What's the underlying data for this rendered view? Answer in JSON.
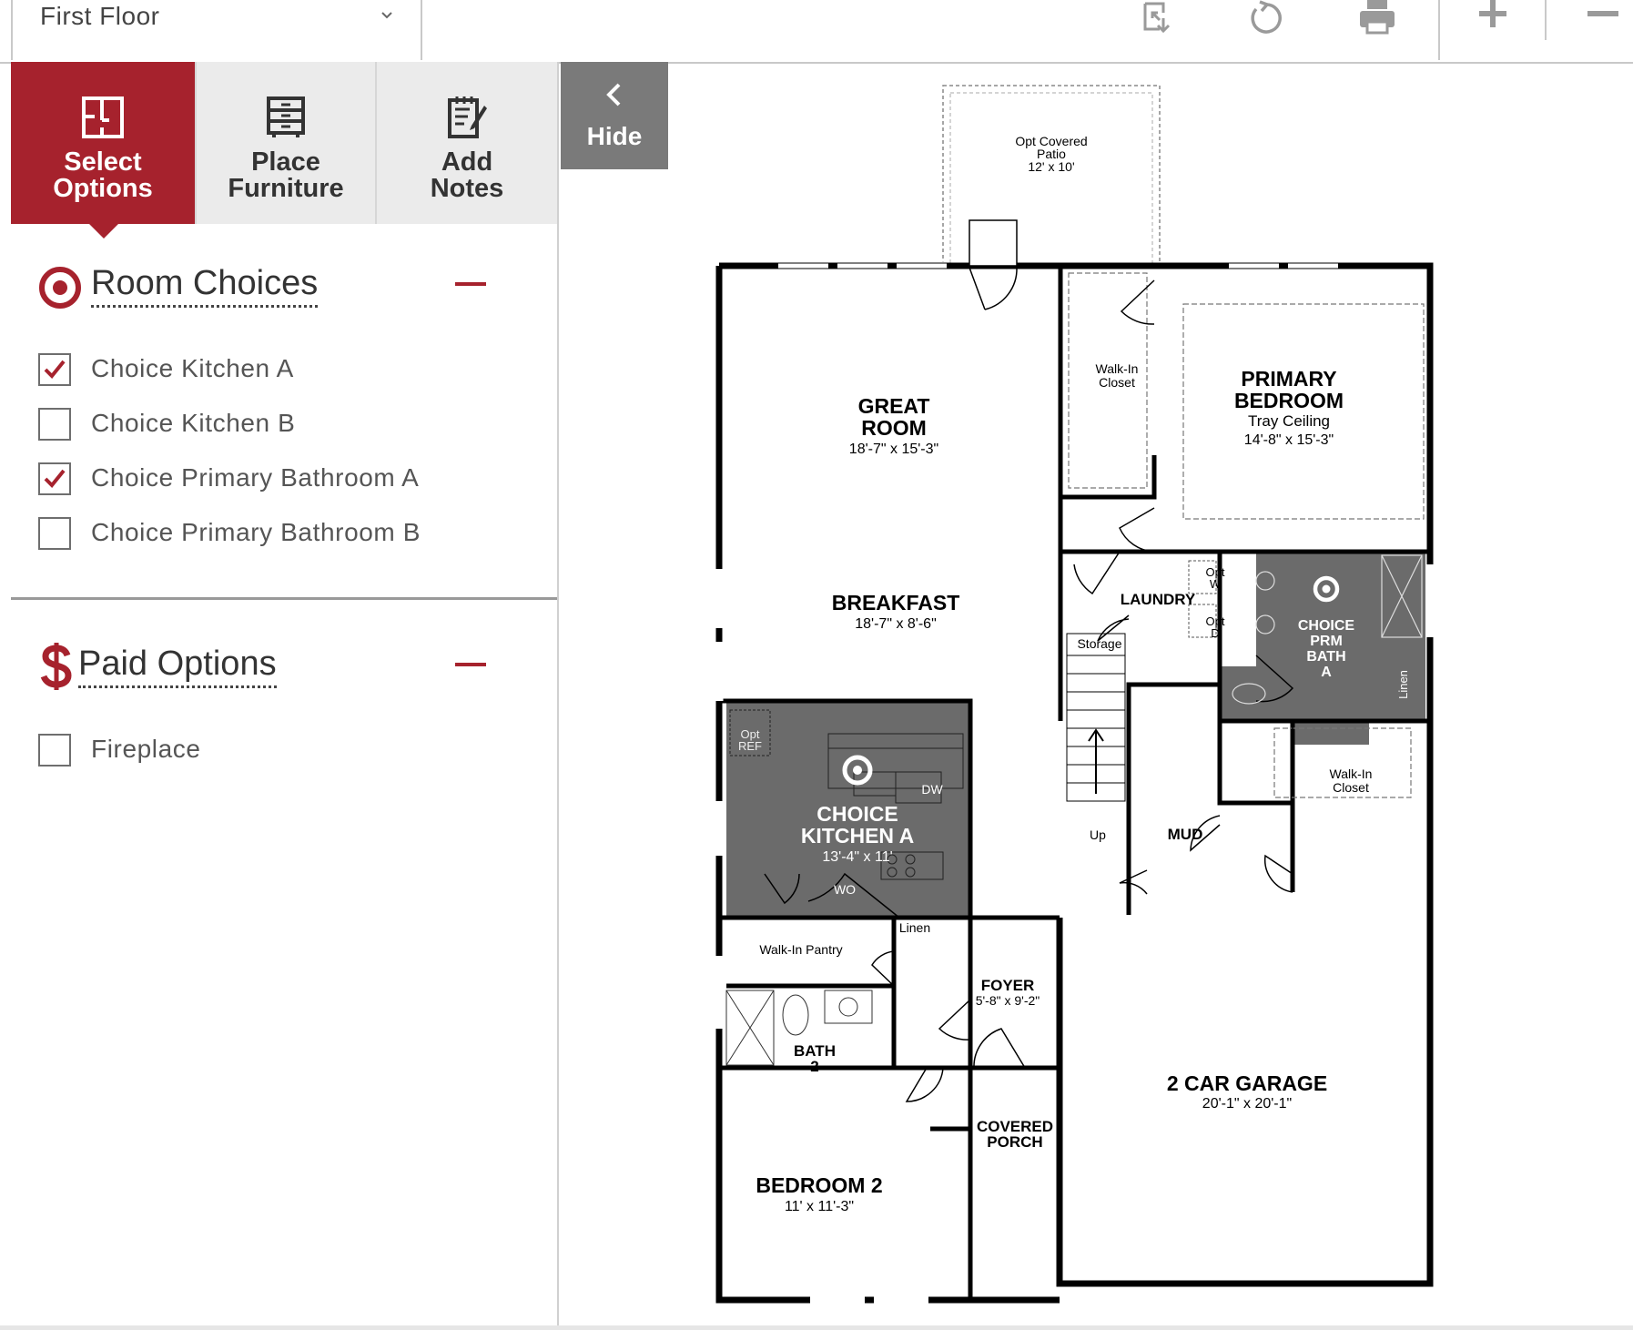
{
  "toolbar": {
    "floor_selected": "First Floor",
    "icons": [
      "swap-icon",
      "reset-icon",
      "print-icon",
      "zoom-in-icon",
      "zoom-out-icon"
    ]
  },
  "tabs": [
    {
      "label": "Select\nOptions",
      "active": true,
      "icon": "floorplan-icon"
    },
    {
      "label": "Place\nFurniture",
      "active": false,
      "icon": "dresser-icon"
    },
    {
      "label": "Add\nNotes",
      "active": false,
      "icon": "notepad-icon"
    }
  ],
  "room_choices": {
    "title": "Room Choices",
    "icon": "target-icon",
    "items": [
      {
        "label": "Choice Kitchen A",
        "checked": true
      },
      {
        "label": "Choice Kitchen B",
        "checked": false
      },
      {
        "label": "Choice Primary Bathroom A",
        "checked": true
      },
      {
        "label": "Choice Primary Bathroom B",
        "checked": false
      }
    ]
  },
  "paid_options": {
    "title": "Paid Options",
    "icon": "dollar-icon",
    "items": [
      {
        "label": "Fireplace",
        "checked": false
      }
    ]
  },
  "hide_button": {
    "label": "Hide"
  },
  "colors": {
    "accent": "#a6222d",
    "tab_bg": "#ebebeb",
    "highlight_room": "#6b6b6b"
  },
  "floorplan": {
    "rooms": {
      "patio_1": "Opt Covered",
      "patio_2": "Patio",
      "patio_dim": "12' x 10'",
      "great_room_1": "GREAT",
      "great_room_2": "ROOM",
      "great_room_dim": "18'-7\" x 15'-3\"",
      "walkin_closet_1a": "Walk-In",
      "walkin_closet_1b": "Closet",
      "primary_bedroom_1": "PRIMARY",
      "primary_bedroom_2": "BEDROOM",
      "primary_bedroom_note": "Tray Ceiling",
      "primary_bedroom_dim": "14'-8\" x 15'-3\"",
      "breakfast": "BREAKFAST",
      "breakfast_dim": "18'-7\" x 8'-6\"",
      "laundry": "LAUNDRY",
      "storage": "Storage",
      "opt_w_1": "Opt",
      "opt_w_2": "W",
      "opt_d_1": "Opt",
      "opt_d_2": "D",
      "choice_bath_1": "CHOICE",
      "choice_bath_2": "PRM",
      "choice_bath_3": "BATH",
      "choice_bath_4": "A",
      "linen_1": "Linen",
      "walkin_closet_2a": "Walk-In",
      "walkin_closet_2b": "Closet",
      "up": "Up",
      "mud": "MUD",
      "opt_ref_1": "Opt",
      "opt_ref_2": "REF",
      "dw": "DW",
      "choice_kitchen_1": "CHOICE",
      "choice_kitchen_2": "KITCHEN A",
      "choice_kitchen_dim": "13'-4\" x 11'",
      "wo": "WO",
      "pantry": "Walk-In Pantry",
      "linen_2": "Linen",
      "foyer": "FOYER",
      "foyer_dim": "5'-8\" x 9'-2\"",
      "bath2_1": "BATH",
      "bath2_2": "2",
      "covered_porch_1": "COVERED",
      "covered_porch_2": "PORCH",
      "garage": "2 CAR GARAGE",
      "garage_dim": "20'-1\" x 20'-1\"",
      "bedroom2": "BEDROOM 2",
      "bedroom2_dim": "11' x 11'-3\""
    }
  }
}
